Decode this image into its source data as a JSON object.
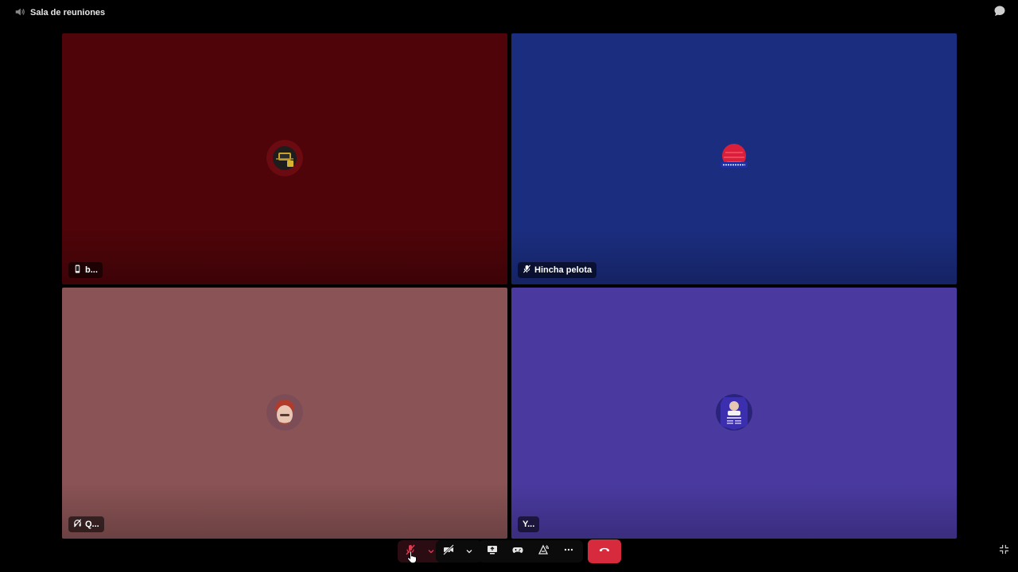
{
  "header": {
    "room_name": "Sala de reuniones",
    "room_icon": "speaker-icon",
    "chat_icon": "chat-bubble-icon"
  },
  "tiles": [
    {
      "label": "b...",
      "status_icon": "mobile-phone-icon",
      "background": "#4e0409",
      "avatar": "gaming-logo-avatar"
    },
    {
      "label": "Hincha pelota",
      "status_icon": "microphone-muted-icon",
      "background": "#1b2d7f",
      "avatar": "hinchapelota-logo-avatar"
    },
    {
      "label": "Q...",
      "status_icon": "headset-deafened-icon",
      "background": "#8a5355",
      "avatar": "person-red-hair-avatar"
    },
    {
      "label": "Y...",
      "status_icon": "",
      "background": "#4a3aa0",
      "avatar": "player-card-avatar"
    }
  ],
  "controls": {
    "mic": "microphone-muted-icon",
    "camera": "camera-off-icon",
    "share": "screen-share-icon",
    "activity": "game-controller-icon",
    "soundboard": "soundboard-icon",
    "more": "more-icon",
    "end_call": "hang-up-icon",
    "collapse": "collapse-icon"
  },
  "colors": {
    "end_call": "#d72a3c",
    "mic_muted": "#e03a52"
  }
}
